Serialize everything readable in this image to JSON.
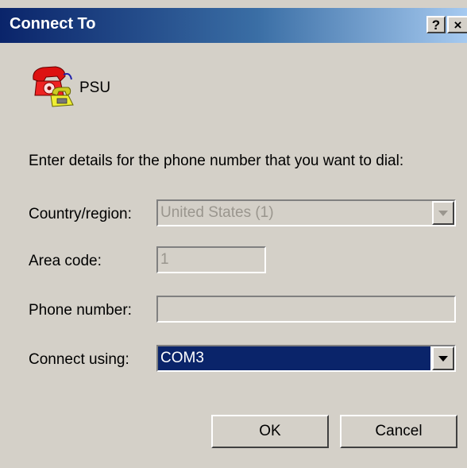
{
  "window": {
    "title": "Connect To",
    "help_glyph": "?",
    "close_glyph": "×"
  },
  "connection": {
    "icon": "phone-connection-icon",
    "name": "PSU"
  },
  "instructions": "Enter details for the phone number that you want to dial:",
  "form": {
    "country_label": "Country/region:",
    "country_value": "United States (1)",
    "area_label": "Area code:",
    "area_value": "1",
    "phone_label": "Phone number:",
    "phone_value": "",
    "connect_label": "Connect using:",
    "connect_value": "COM3"
  },
  "buttons": {
    "ok": "OK",
    "cancel": "Cancel"
  },
  "colors": {
    "title_bar": "#0a246a",
    "dialog_face": "#d4d0c8",
    "selection": "#0a246a"
  }
}
